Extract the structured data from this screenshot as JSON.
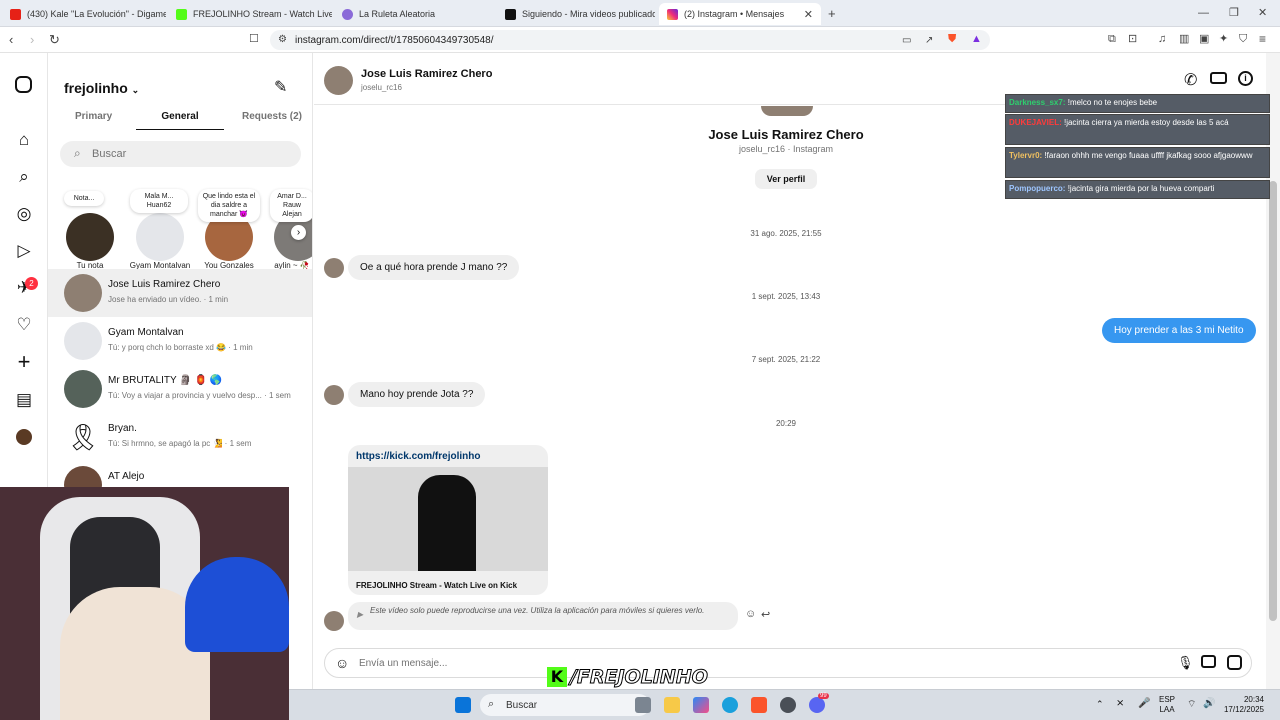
{
  "browser": {
    "tabs": [
      {
        "title": "(430) Kale \"La Evolución\" - Digame U"
      },
      {
        "title": "FREJOLINHO Stream - Watch Live on"
      },
      {
        "title": "La Ruleta Aleatoria"
      },
      {
        "title": "Siguiendo - Mira videos publicados p"
      },
      {
        "title": "(2) Instagram • Mensajes"
      }
    ],
    "url": "instagram.com/direct/t/17850604349730548/"
  },
  "ig_nav": {
    "badge_count": "2"
  },
  "inbox": {
    "username": "frejolinho",
    "tabs": [
      "Primary",
      "General",
      "Requests (2)"
    ],
    "search_placeholder": "Buscar",
    "notes": [
      {
        "bubble": "Nota...",
        "name": "Tu nota"
      },
      {
        "bubble": "Mala M... Huan62",
        "name": "Gyam Montalvan"
      },
      {
        "bubble": "Que lindo esta el dia saldre a manchar 😈",
        "name": "You Gonzales"
      },
      {
        "bubble": "Amar D... Rauw Alejan",
        "name": "aylin ~ 🥀"
      }
    ],
    "threads": [
      {
        "name": "Jose Luis Ramirez Chero",
        "message": "Jose ha enviado un vídeo. · 1 min"
      },
      {
        "name": "Gyam Montalvan",
        "message": "Tú: y porq chch lo borraste xd 😂 · 1 min"
      },
      {
        "name": "Mr BRUTALITY 🗿 🏮 🌎",
        "message": "Tú: Voy a viajar a provincia y vuelvo desp... · 1 sem"
      },
      {
        "name": "Bryan.",
        "message": "Tú: Si hrmno, se apagó la pc 🧏 · 1 sem"
      },
      {
        "name": "AT Alejo",
        "message": ""
      }
    ]
  },
  "chat": {
    "header_name": "Jose Luis Ramirez Chero",
    "header_user": "joselu_rc16",
    "profile_name": "Jose Luis Ramirez Chero",
    "profile_sub": "joselu_rc16 · Instagram",
    "view_profile": "Ver perfil",
    "timestamps": [
      "31 ago. 2025, 21:55",
      "1 sept. 2025, 13:43",
      "7 sept. 2025, 21:22",
      "20:29"
    ],
    "messages": [
      {
        "text": "Oe a qué hora prende J mano ??"
      },
      {
        "text": "Hoy prender a las 3 mi Netito"
      },
      {
        "text": "Mano hoy prende Jota ??"
      }
    ],
    "link_card": {
      "url": "https://kick.com/frejolinho",
      "title": "FREJOLINHO Stream - Watch Live on Kick"
    },
    "video_notice": "Este vídeo solo puede reproducirse una vez. Utiliza la aplicación para móviles si quieres verlo.",
    "composer_placeholder": "Envía un mensaje..."
  },
  "stream_chat": [
    {
      "user": "Darkness_sx7:",
      "text": "!melco no te enojes bebe"
    },
    {
      "user": "DUKEJAVIEL:",
      "text": "!jacinta cierra ya mierda estoy desde las 5 acá"
    },
    {
      "user": "Tylervr0:",
      "text": "!faraon ohhh me vengo fuaaa uffff jkafkag sooo afjgaowww"
    },
    {
      "user": "Pompopuerco:",
      "text": "!jacinta gira mierda por la hueva comparti"
    }
  ],
  "overlay_brand": "/FREJOLINHO",
  "taskbar": {
    "search_placeholder": "Buscar",
    "lang": "ESP",
    "lang2": "LAA",
    "time": "20:34",
    "date": "17/12/2025",
    "discord_badge": "99"
  },
  "colors": {
    "accent": "#3797f0",
    "kick_green": "#53fc18"
  }
}
